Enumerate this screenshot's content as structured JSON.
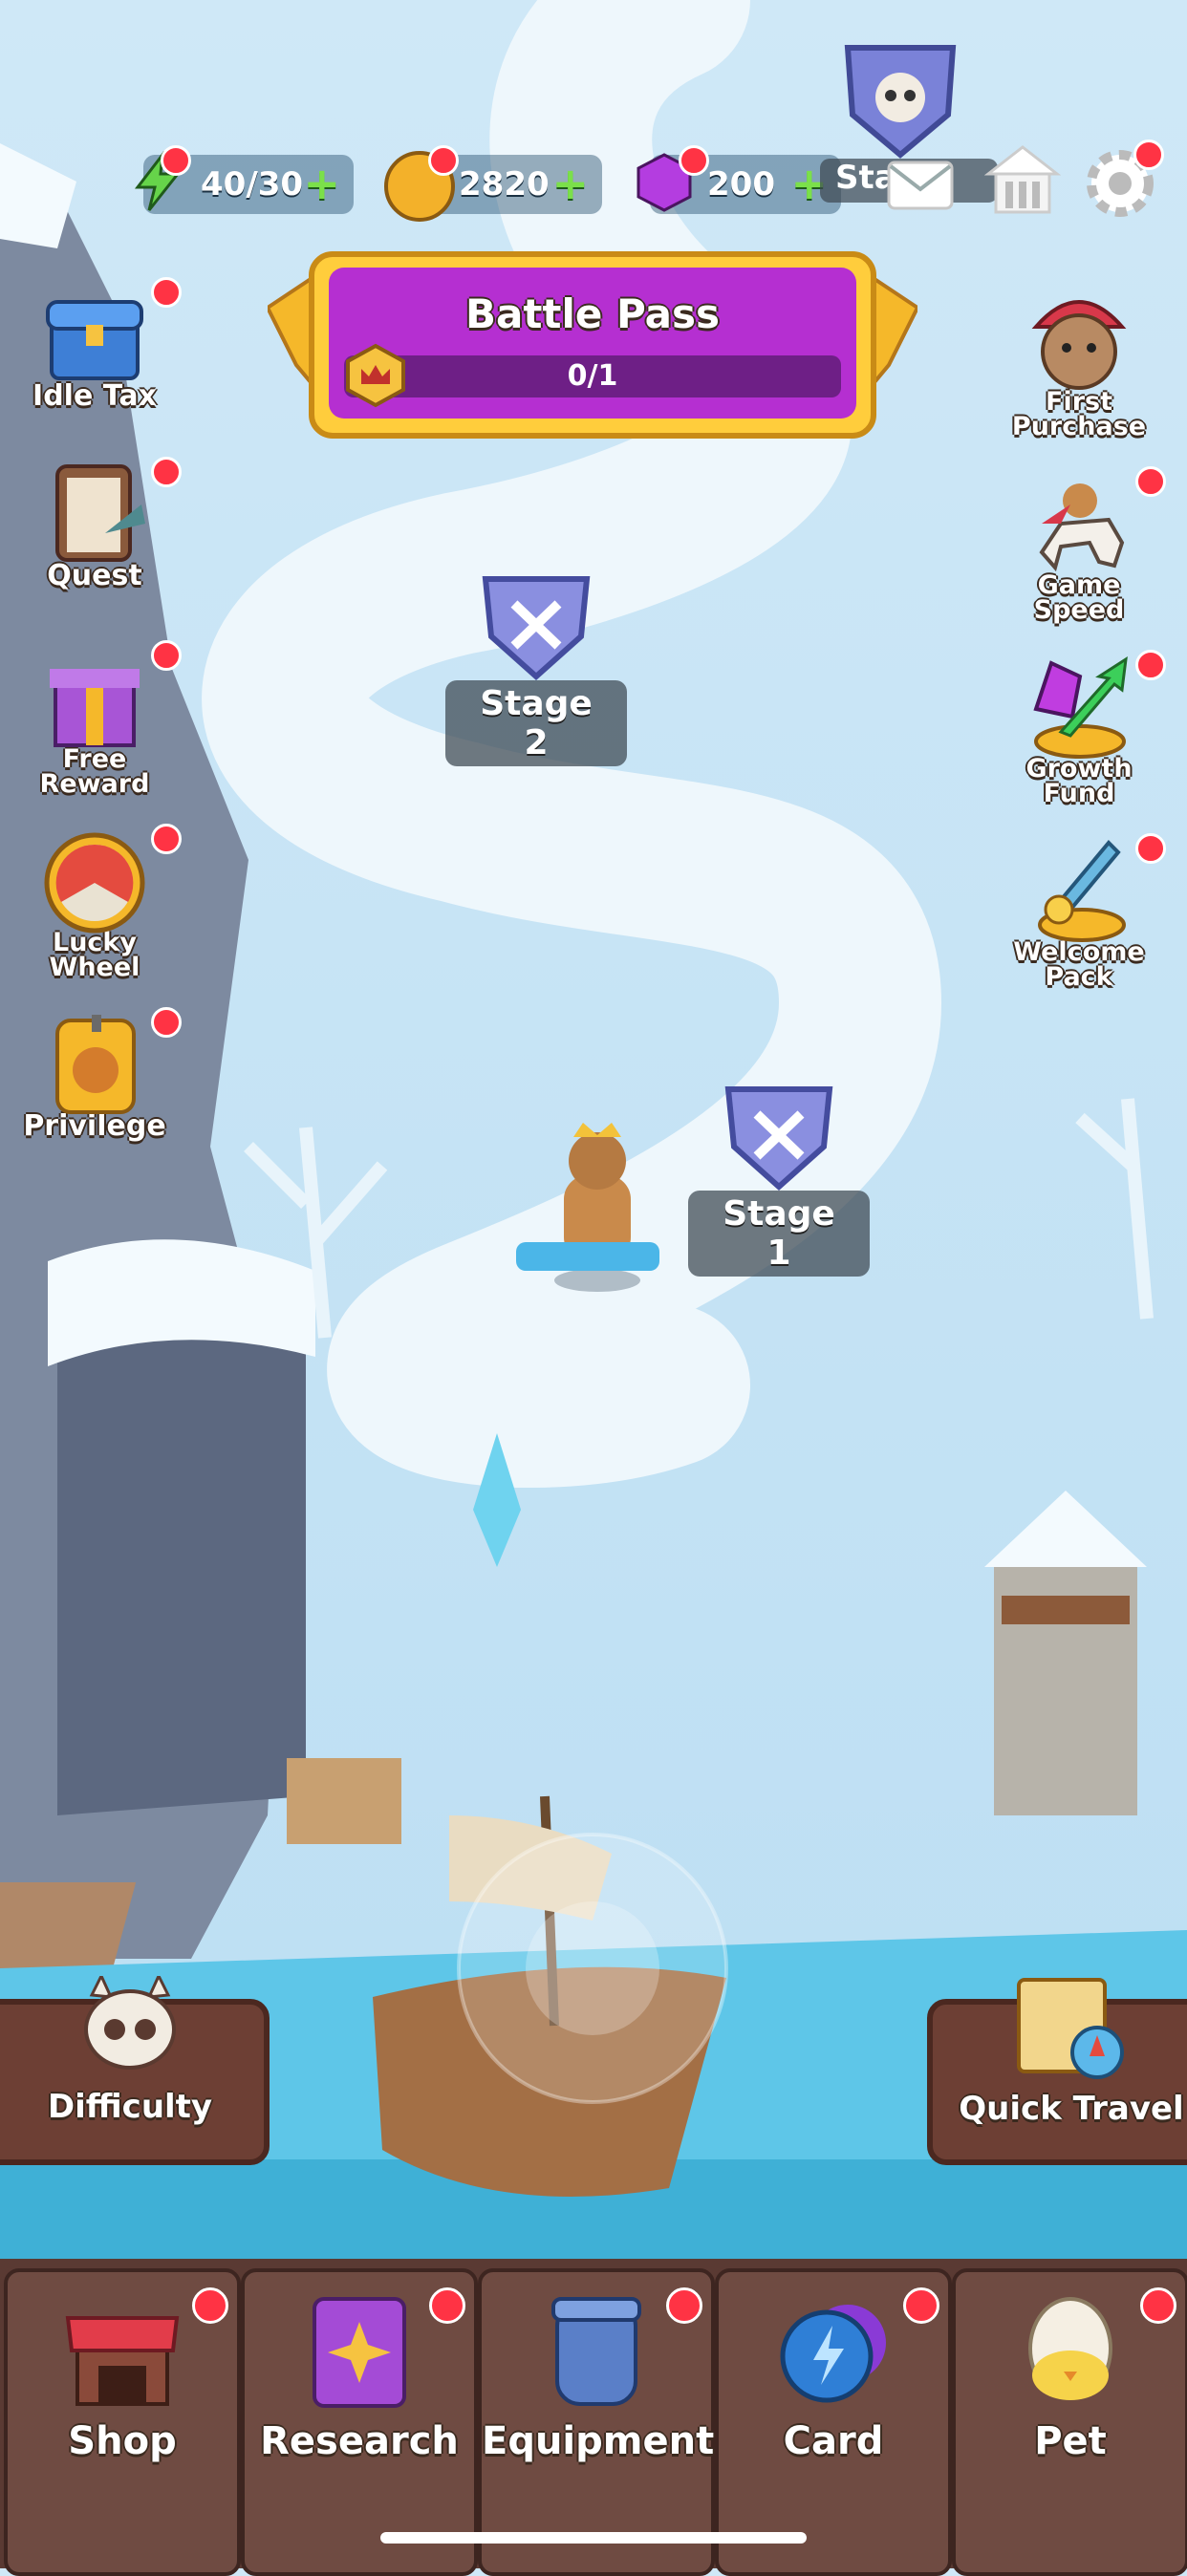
{
  "resources": {
    "energy": {
      "value": "40/30",
      "icon": "lightning-icon"
    },
    "gold": {
      "value": "2820",
      "icon": "gold-coin-icon"
    },
    "gems": {
      "value": "200",
      "icon": "gem-icon"
    }
  },
  "top_right": {
    "partial_stage_label": "Sta",
    "icons": [
      "mail-icon",
      "home-icon",
      "gear-icon"
    ]
  },
  "battle_pass": {
    "title": "Battle Pass",
    "progress_text": "0/1",
    "progress": 0.0
  },
  "left_menu": [
    {
      "label": "Idle Tax",
      "icon": "treasure-chest-icon",
      "has_badge": true
    },
    {
      "label": "Quest",
      "icon": "clipboard-icon",
      "has_badge": true
    },
    {
      "label": "Free\nReward",
      "icon": "gift-box-icon",
      "has_badge": true
    },
    {
      "label": "Lucky\nWheel",
      "icon": "wheel-icon",
      "has_badge": true
    },
    {
      "label": "Privilege",
      "icon": "ticket-icon",
      "has_badge": true
    }
  ],
  "right_menu": [
    {
      "label": "First\nPurchase",
      "icon": "cat-merchant-icon",
      "has_badge": false
    },
    {
      "label": "Game\nSpeed",
      "icon": "horse-rider-icon",
      "has_badge": true
    },
    {
      "label": "Growth\nFund",
      "icon": "growth-gems-icon",
      "has_badge": true
    },
    {
      "label": "Welcome\nPack",
      "icon": "gold-sword-icon",
      "has_badge": true
    }
  ],
  "stages": [
    {
      "label": "Stage 2"
    },
    {
      "label": "Stage 1"
    }
  ],
  "buttons": {
    "difficulty": "Difficulty",
    "quick_travel": "Quick Travel"
  },
  "nav": [
    {
      "label": "Shop",
      "icon": "shop-stall-icon",
      "has_badge": true
    },
    {
      "label": "Research",
      "icon": "research-book-icon",
      "has_badge": true
    },
    {
      "label": "Equipment",
      "icon": "equipment-pot-icon",
      "has_badge": true
    },
    {
      "label": "Card",
      "icon": "card-lightning-icon",
      "has_badge": true
    },
    {
      "label": "Pet",
      "icon": "egg-chick-icon",
      "has_badge": true
    }
  ],
  "colors": {
    "snow": "#e8f4fb",
    "water": "#5ec6e8",
    "battle_pass_purple": "#b52fd1",
    "nav_brown": "#6f4b42",
    "badge_red": "#ff3344"
  }
}
